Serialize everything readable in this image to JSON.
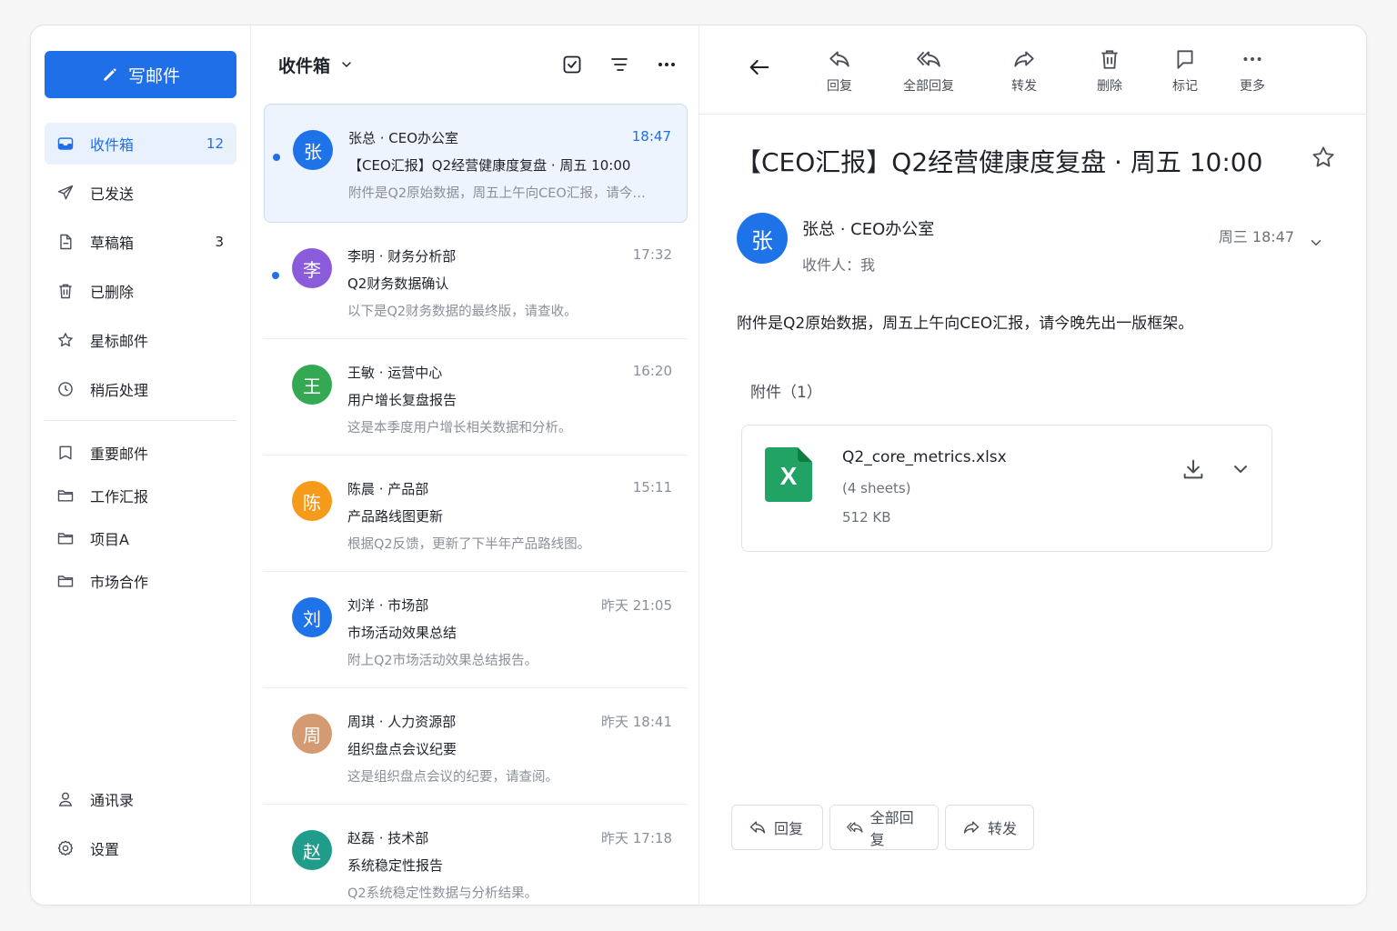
{
  "sidebar": {
    "compose_label": "写邮件",
    "nav": [
      {
        "label": "收件箱",
        "count": "12",
        "icon": "inbox-icon"
      },
      {
        "label": "已发送",
        "count": "",
        "icon": "send-icon"
      },
      {
        "label": "草稿箱",
        "count": "3",
        "icon": "draft-icon"
      },
      {
        "label": "已删除",
        "count": "",
        "icon": "trash-icon"
      },
      {
        "label": "星标邮件",
        "count": "",
        "icon": "star-icon"
      },
      {
        "label": "稍后处理",
        "count": "",
        "icon": "clock-icon"
      }
    ],
    "folders": [
      {
        "label": "重要邮件",
        "icon": "bookmark-icon"
      },
      {
        "label": "工作汇报",
        "icon": "folder-icon"
      },
      {
        "label": "项目A",
        "icon": "folder-icon"
      },
      {
        "label": "市场合作",
        "icon": "folder-icon"
      }
    ],
    "bottom": [
      {
        "label": "通讯录",
        "icon": "contacts-icon"
      },
      {
        "label": "设置",
        "icon": "settings-icon"
      }
    ]
  },
  "list": {
    "title": "收件箱",
    "items": [
      {
        "sender": "张总 · CEO办公室",
        "time": "18:47",
        "subject": "【CEO汇报】Q2经营健康度复盘 · 周五 10:00",
        "preview": "附件是Q2原始数据，周五上午向CEO汇报，请今晚先出一版框架。",
        "avatar": "张",
        "avatar_color": "#1e73e8",
        "unread": true
      },
      {
        "sender": "李明 · 财务分析部",
        "time": "17:32",
        "subject": "Q2财务数据确认",
        "preview": "以下是Q2财务数据的最终版，请查收。",
        "avatar": "李",
        "avatar_color": "#8a5cdb",
        "unread": true
      },
      {
        "sender": "王敏 · 运营中心",
        "time": "16:20",
        "subject": "用户增长复盘报告",
        "preview": "这是本季度用户增长相关数据和分析。",
        "avatar": "王",
        "avatar_color": "#34a853",
        "unread": false
      },
      {
        "sender": "陈晨 · 产品部",
        "time": "15:11",
        "subject": "产品路线图更新",
        "preview": "根据Q2反馈，更新了下半年产品路线图。",
        "avatar": "陈",
        "avatar_color": "#f59a1b",
        "unread": false
      },
      {
        "sender": "刘洋 · 市场部",
        "time": "昨天 21:05",
        "subject": "市场活动效果总结",
        "preview": "附上Q2市场活动效果总结报告。",
        "avatar": "刘",
        "avatar_color": "#1e73e8",
        "unread": false
      },
      {
        "sender": "周琪 · 人力资源部",
        "time": "昨天 18:41",
        "subject": "组织盘点会议纪要",
        "preview": "这是组织盘点会议的纪要，请查阅。",
        "avatar": "周",
        "avatar_color": "#d49a72",
        "unread": false
      },
      {
        "sender": "赵磊 · 技术部",
        "time": "昨天 17:18",
        "subject": "系统稳定性报告",
        "preview": "Q2系统稳定性数据与分析结果。",
        "avatar": "赵",
        "avatar_color": "#1f9d8a",
        "unread": false
      }
    ]
  },
  "toolbar": {
    "reply": "回复",
    "reply_all": "全部回复",
    "forward": "转发",
    "delete": "删除",
    "mark": "标记",
    "more": "更多"
  },
  "message": {
    "subject": "【CEO汇报】Q2经营健康度复盘 · 周五 10:00",
    "avatar": "张",
    "from": "张总 · CEO办公室",
    "to": "收件人：我",
    "date": "周三 18:47",
    "body": "附件是Q2原始数据，周五上午向CEO汇报，请今晚先出一版框架。",
    "attachments_title": "附件（1）",
    "attachment": {
      "name": "Q2_core_metrics.xlsx",
      "sheets": "(4 sheets)",
      "size": "512 KB",
      "badge": "X"
    }
  },
  "actions": {
    "reply": "回复",
    "reply_all": "全部回复",
    "forward": "转发"
  },
  "colors": {
    "accent": "#1e6fe8",
    "selected_bg": "#edf4fe",
    "excel_green": "#21a366"
  }
}
